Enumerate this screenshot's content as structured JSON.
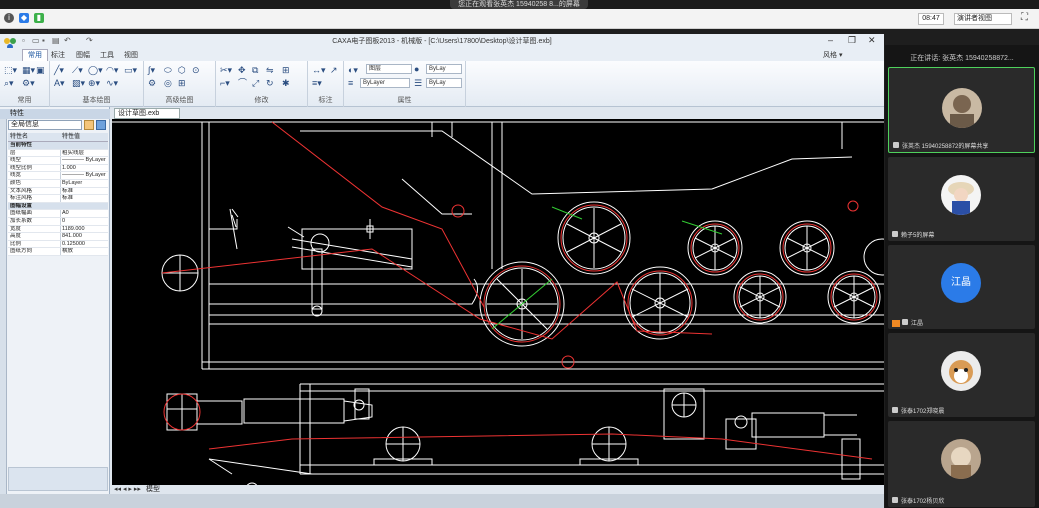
{
  "meeting": {
    "share_banner": "您正在观看张英杰 15940258 8...的屏幕",
    "time": "08:47",
    "view_mode": "演讲者视图",
    "speaking_label": "正在讲话: 张英杰 15940258872...",
    "participants": [
      {
        "name": "张英杰 15940258872的屏幕共享",
        "active": true,
        "avatar": "photo-man-icon"
      },
      {
        "name": "赖子5的屏幕",
        "active": false,
        "avatar": "photo-girl-icon"
      },
      {
        "name": "江晶",
        "active": false,
        "avatar": "initial",
        "initial": "江晶"
      },
      {
        "name": "张泰1702郑晓晨",
        "active": false,
        "avatar": "photo-cat-icon"
      },
      {
        "name": "张泰1702杨贝欣",
        "active": false,
        "avatar": "photo-dog-icon"
      }
    ]
  },
  "cad": {
    "title": "CAXA电子图板2013 - 机械版 - [C:\\Users\\17800\\Desktop\\设计草图.exb]",
    "tabs": [
      "常用",
      "标注",
      "图幅",
      "工具",
      "视图"
    ],
    "active_tab": "常用",
    "ribbon_right": "风格 ▾",
    "groups": [
      "常用",
      "基本绘图",
      "高级绘图",
      "修改",
      "标注",
      "属性"
    ],
    "layer_combo": "ByLay",
    "linetype_combo": "ByLayer",
    "lineweight_combo": "ByLay",
    "layer_name": "图层",
    "document_tab": "设计草图.exb",
    "layout_tab": "模型",
    "properties": {
      "header": "特性",
      "selector": "全局信息",
      "col_name": "特性名",
      "col_value": "特性值",
      "rows": [
        {
          "k": "当前特性",
          "v": "",
          "cat": true
        },
        {
          "k": "层",
          "v": "粗实线层"
        },
        {
          "k": "线型",
          "v": "———— ByLayer"
        },
        {
          "k": "线型比例",
          "v": "1.000"
        },
        {
          "k": "线宽",
          "v": "———— ByLayer"
        },
        {
          "k": "颜色",
          "v": "ByLayer"
        },
        {
          "k": "文本风格",
          "v": "标准"
        },
        {
          "k": "标注风格",
          "v": "标准"
        },
        {
          "k": "图幅设置",
          "v": "",
          "cat": true
        },
        {
          "k": "图纸幅面",
          "v": "A0"
        },
        {
          "k": "加长系数",
          "v": "0"
        },
        {
          "k": "宽度",
          "v": "1189.000"
        },
        {
          "k": "高度",
          "v": "841.000"
        },
        {
          "k": "比例",
          "v": "0.125000"
        },
        {
          "k": "图纸方向",
          "v": "横放"
        }
      ]
    }
  }
}
